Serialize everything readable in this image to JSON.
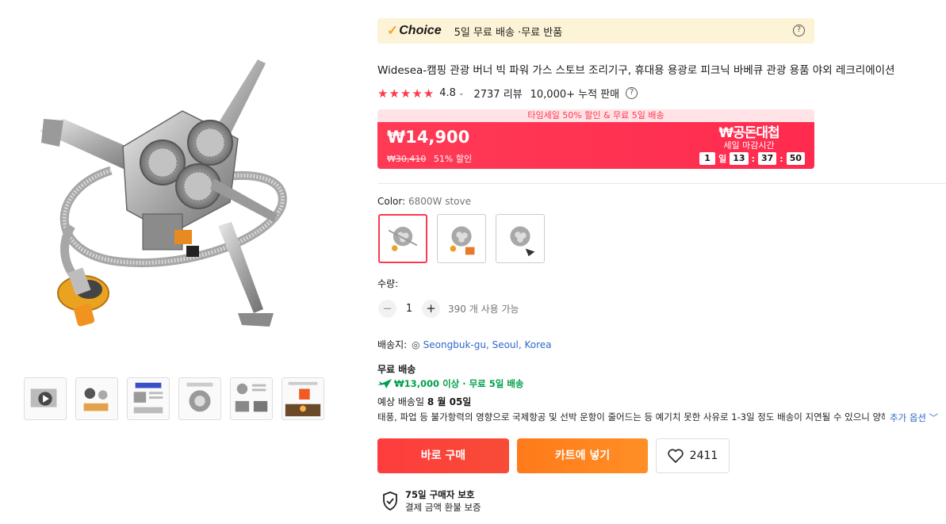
{
  "choice": {
    "logo": "Choice",
    "text": "5일 무료 배송 ·무료 반품"
  },
  "product": {
    "title": "Widesea-캠핑 관광 버너 빅 파워 가스 스토브 조리기구, 휴대용 용광로 피크닉 바베큐 관광 용품 야외 레크리에이션"
  },
  "rating": {
    "stars": "★★★★★",
    "score": "4.8",
    "reviews": "2737 리뷰",
    "sold": "10,000+ 누적 판매"
  },
  "sale": {
    "banner": "타임세일 50% 할인 & 무료 5일 배송",
    "price": "₩14,900",
    "original": "₩30,410",
    "discount": "51% 할인",
    "promo_brand": "₩공돈대첩",
    "promo_sub": "세일 마감시간",
    "countdown": {
      "days": "1",
      "day_unit": "일",
      "hours": "13",
      "minutes": "37",
      "seconds": "50"
    }
  },
  "variant": {
    "label": "Color: ",
    "value": "6800W stove",
    "options": [
      "option-1",
      "option-2",
      "option-3"
    ],
    "selected_index": 0
  },
  "quantity": {
    "label": "수량:",
    "value": "1",
    "minus": "−",
    "plus": "+",
    "available": "390 개 사용 가능"
  },
  "shipping": {
    "to_label": "배송지:",
    "location": "Seongbuk-gu, Seoul, Korea",
    "free_label": "무료 배송",
    "condition": "₩13,000 이상 · 무료 5일 배송",
    "eta_prefix": "예상 배송일 ",
    "eta_date": "8 월 05일",
    "notice": "태풍, 파업 등 불가항력의 영향으로 국제항공 및 선박 운항이 줄어드는 등 예기치 못한 사유로 1-3일 정도 배송이 지연될 수 있으니 양해 부탁",
    "more_options": "추가 옵션 ﹀"
  },
  "actions": {
    "buy_now": "바로 구매",
    "add_to_cart": "카트에 넣기",
    "wishlist_count": "2411"
  },
  "protection": {
    "title": "75일 구매자 보호",
    "subtitle": "결제 금액 환불 보증"
  },
  "colors": {
    "accent_red": "#fd384f",
    "buy_button": "#fd3c3e",
    "cart_button": "#ff8a22",
    "link_blue": "#2e69c9",
    "ship_green": "#00a04a",
    "choice_bg": "#fdf3d6"
  },
  "icons": {
    "choice_tick": "✓",
    "help": "?",
    "caret": "⌄",
    "pin": "◎",
    "heart": "heart-icon",
    "shield": "shield-check-icon",
    "plane": "plane-icon"
  }
}
